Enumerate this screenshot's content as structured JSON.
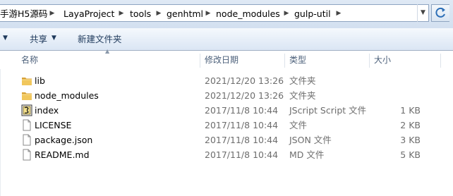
{
  "breadcrumb": [
    "手游H5源码",
    "LayaProject",
    "tools",
    "genhtml",
    "node_modules",
    "gulp-util"
  ],
  "toolbar": {
    "share_label": "共享",
    "new_folder_label": "新建文件夹"
  },
  "columns": {
    "name": "名称",
    "date": "修改日期",
    "type": "类型",
    "size": "大小"
  },
  "files": [
    {
      "name": "lib",
      "date": "2021/12/20 13:26",
      "type": "文件夹",
      "size": "",
      "icon": "folder-icon"
    },
    {
      "name": "node_modules",
      "date": "2021/12/20 13:26",
      "type": "文件夹",
      "size": "",
      "icon": "folder-icon"
    },
    {
      "name": "index",
      "date": "2017/11/8 10:44",
      "type": "JScript Script 文件",
      "size": "1 KB",
      "icon": "jscript-file-icon"
    },
    {
      "name": "LICENSE",
      "date": "2017/11/8 10:44",
      "type": "文件",
      "size": "2 KB",
      "icon": "blank-file-icon"
    },
    {
      "name": "package.json",
      "date": "2017/11/8 10:44",
      "type": "JSON 文件",
      "size": "3 KB",
      "icon": "blank-file-icon"
    },
    {
      "name": "README.md",
      "date": "2017/11/8 10:44",
      "type": "MD 文件",
      "size": "5 KB",
      "icon": "blank-file-icon"
    }
  ],
  "colors": {
    "folder": "#e8b84a",
    "header_text": "#4c607a",
    "toolbar_text": "#1e395b"
  }
}
